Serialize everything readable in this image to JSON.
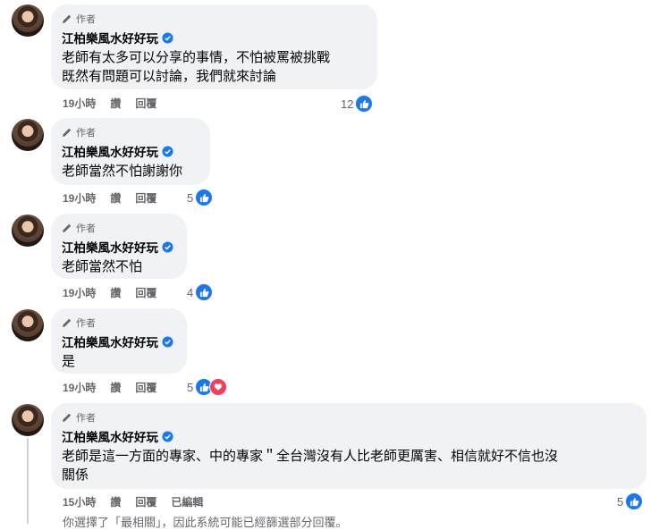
{
  "comments": [
    {
      "badge": "作者",
      "name": "江柏樂風水好好玩",
      "text": "老師有太多可以分享的事情，不怕被罵被挑戰\n既然有問題可以討論，我們就來討論",
      "time": "19小時",
      "like": "讚",
      "reply": "回覆",
      "edited": "",
      "reactions": {
        "count": "12",
        "types": [
          "like"
        ]
      }
    },
    {
      "badge": "作者",
      "name": "江柏樂風水好好玩",
      "text": "老師當然不怕謝謝你",
      "time": "19小時",
      "like": "讚",
      "reply": "回覆",
      "edited": "",
      "reactions": {
        "count": "5",
        "types": [
          "like"
        ]
      }
    },
    {
      "badge": "作者",
      "name": "江柏樂風水好好玩",
      "text": "老師當然不怕",
      "time": "19小時",
      "like": "讚",
      "reply": "回覆",
      "edited": "",
      "reactions": {
        "count": "4",
        "types": [
          "like"
        ]
      }
    },
    {
      "badge": "作者",
      "name": "江柏樂風水好好玩",
      "text": "是",
      "time": "19小時",
      "like": "讚",
      "reply": "回覆",
      "edited": "",
      "reactions": {
        "count": "5",
        "types": [
          "like",
          "love"
        ]
      }
    },
    {
      "badge": "作者",
      "name": "江柏樂風水好好玩",
      "text": "老師是這一方面的專家、中的專家＂全台灣沒有人比老師更厲害、相信就好不信也沒\n關係",
      "time": "15小時",
      "like": "讚",
      "reply": "回覆",
      "edited": "已編輯",
      "reactions": {
        "count": "5",
        "types": [
          "like"
        ]
      }
    }
  ],
  "footer": {
    "text": "你選擇了「最相關」，因此系統可能已經篩選部分回覆。"
  },
  "colors": {
    "bubble": "#f0f2f5",
    "like": "#1877f2",
    "love": "#f33e58",
    "verified": "#1877f2"
  }
}
